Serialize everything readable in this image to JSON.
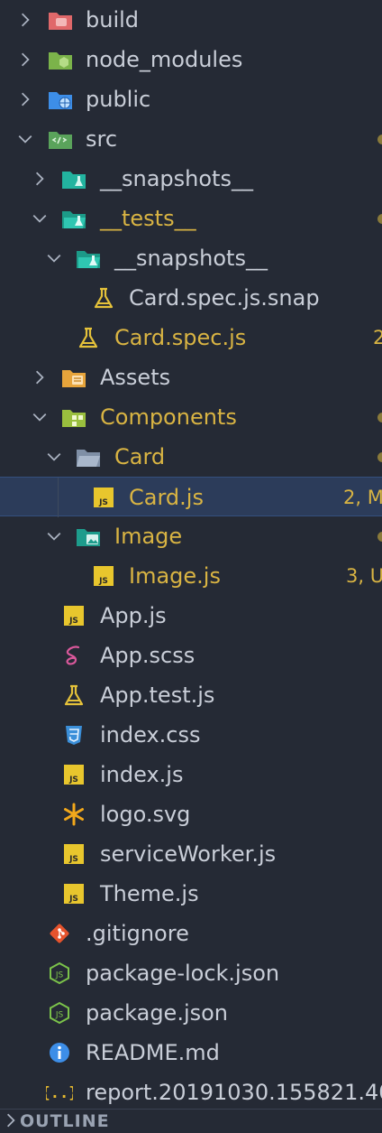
{
  "explorer": {
    "items": [
      {
        "label": "build",
        "icon": "folder-build-icon",
        "chevron": "right",
        "mod": false
      },
      {
        "label": "node_modules",
        "icon": "folder-node-icon",
        "chevron": "right",
        "mod": false
      },
      {
        "label": "public",
        "icon": "folder-public-icon",
        "chevron": "right",
        "mod": false
      },
      {
        "label": "src",
        "icon": "folder-src-icon",
        "chevron": "down",
        "mod": false,
        "dot": true
      },
      {
        "label": "__snapshots__",
        "icon": "folder-test-icon",
        "chevron": "right",
        "mod": false
      },
      {
        "label": "__tests__",
        "icon": "folder-test-open-icon",
        "chevron": "down",
        "mod": true,
        "dot": true
      },
      {
        "label": "__snapshots__",
        "icon": "folder-test-open-icon",
        "chevron": "down",
        "mod": false
      },
      {
        "label": "Card.spec.js.snap",
        "icon": "flask-icon",
        "mod": false
      },
      {
        "label": "Card.spec.js",
        "icon": "flask-icon",
        "mod": true,
        "badge": "2"
      },
      {
        "label": "Assets",
        "icon": "folder-assets-icon",
        "chevron": "right",
        "mod": false
      },
      {
        "label": "Components",
        "icon": "folder-components-icon",
        "chevron": "down",
        "mod": true,
        "dot": true
      },
      {
        "label": "Card",
        "icon": "folder-open-icon",
        "chevron": "down",
        "mod": true,
        "dot": true
      },
      {
        "label": "Card.js",
        "icon": "js-file-icon",
        "mod": true,
        "badge": "2, M",
        "selected": true
      },
      {
        "label": "Image",
        "icon": "folder-image-icon",
        "chevron": "down",
        "mod": true,
        "dot": true
      },
      {
        "label": "Image.js",
        "icon": "js-file-icon",
        "mod": true,
        "badge": "3, U"
      },
      {
        "label": "App.js",
        "icon": "js-file-icon",
        "mod": false
      },
      {
        "label": "App.scss",
        "icon": "sass-icon",
        "mod": false
      },
      {
        "label": "App.test.js",
        "icon": "flask-icon",
        "mod": false
      },
      {
        "label": "index.css",
        "icon": "css-icon",
        "mod": false
      },
      {
        "label": "index.js",
        "icon": "js-file-icon",
        "mod": false
      },
      {
        "label": "logo.svg",
        "icon": "svg-asterisk-icon",
        "mod": false
      },
      {
        "label": "serviceWorker.js",
        "icon": "js-file-icon",
        "mod": false
      },
      {
        "label": "Theme.js",
        "icon": "js-file-icon",
        "mod": false
      },
      {
        "label": ".gitignore",
        "icon": "git-icon",
        "mod": false
      },
      {
        "label": "package-lock.json",
        "icon": "nodejs-icon",
        "mod": false
      },
      {
        "label": "package.json",
        "icon": "nodejs-icon",
        "mod": false
      },
      {
        "label": "README.md",
        "icon": "info-icon",
        "mod": false
      },
      {
        "label": "report.20191030.155821.40",
        "icon": "json-braces-icon",
        "mod": false
      }
    ]
  },
  "outline": {
    "title": "OUTLINE"
  },
  "colors": {
    "background": "#252a35",
    "text": "#c9ced8",
    "modified": "#d9b443",
    "selected": "#2c3c5a"
  }
}
